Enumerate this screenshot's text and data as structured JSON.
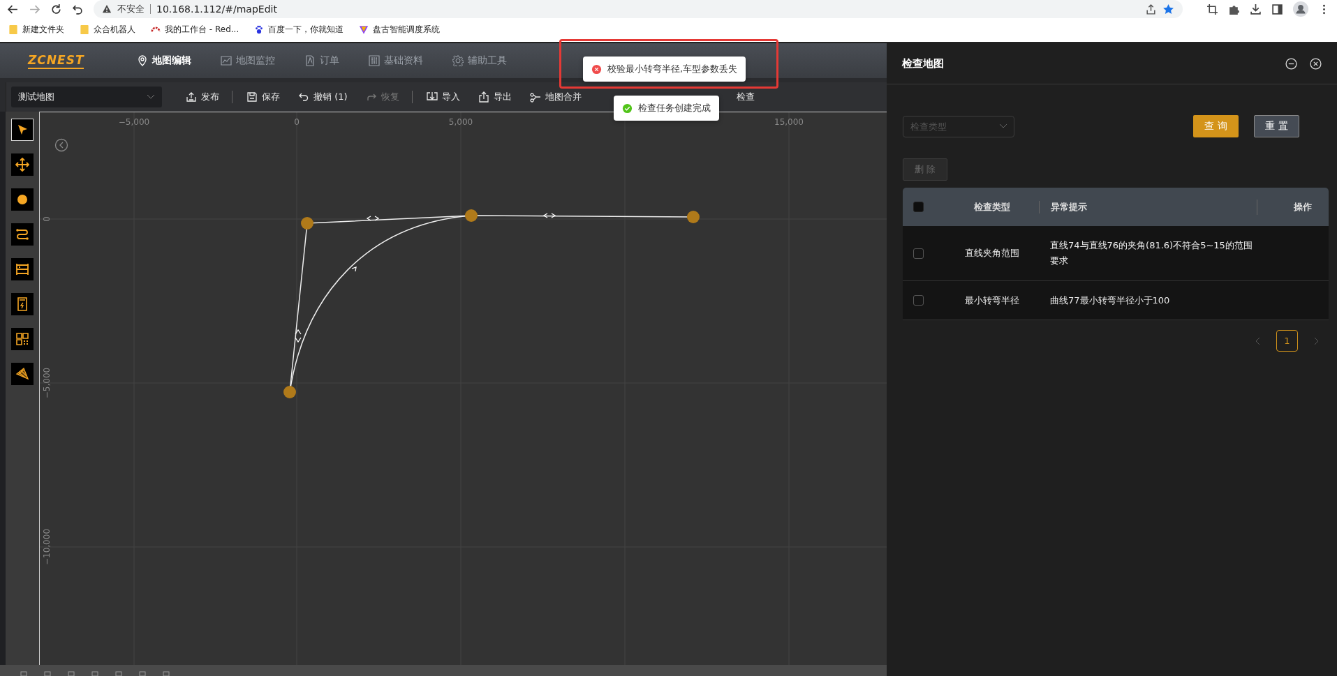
{
  "browser": {
    "security": "不安全",
    "url": "10.168.1.112/#/mapEdit",
    "bookmarks": [
      {
        "label": "新建文件夹",
        "kind": "folder"
      },
      {
        "label": "众合机器人",
        "kind": "folder"
      },
      {
        "label": "我的工作台 - Red...",
        "kind": "arc"
      },
      {
        "label": "百度一下，你就知道",
        "kind": "paw"
      },
      {
        "label": "盘古智能调度系统",
        "kind": "v"
      }
    ]
  },
  "app": {
    "logo": "ZCNEST",
    "nav": [
      {
        "label": "地图编辑",
        "kind": "pin",
        "selected": true
      },
      {
        "label": "地图监控",
        "kind": "chart",
        "selected": false
      },
      {
        "label": "订单",
        "kind": "doc",
        "selected": false
      },
      {
        "label": "基础资料",
        "kind": "sliders",
        "selected": false
      },
      {
        "label": "辅助工具",
        "kind": "gear",
        "selected": false
      }
    ]
  },
  "toolbar": {
    "map_select": "测试地图",
    "actions": [
      {
        "label": "发布",
        "kind": "publish",
        "disabled": false,
        "divider_after": true
      },
      {
        "label": "保存",
        "kind": "save",
        "disabled": false,
        "divider_after": false
      },
      {
        "label": "撤销 (1)",
        "kind": "undo",
        "disabled": false,
        "divider_after": false
      },
      {
        "label": "恢复",
        "kind": "redo",
        "disabled": true,
        "divider_after": true
      },
      {
        "label": "导入",
        "kind": "import",
        "disabled": false,
        "divider_after": false
      },
      {
        "label": "导出",
        "kind": "export",
        "disabled": false,
        "divider_after": false
      },
      {
        "label": "地图合并",
        "kind": "merge",
        "disabled": false,
        "divider_after": false
      },
      {
        "label": "检查",
        "kind": "none",
        "disabled": false,
        "divider_after": false
      }
    ]
  },
  "tools": [
    {
      "kind": "pointer",
      "selected": true
    },
    {
      "kind": "move",
      "selected": false
    },
    {
      "kind": "point",
      "selected": false
    },
    {
      "kind": "route",
      "selected": false
    },
    {
      "kind": "rack",
      "selected": false
    },
    {
      "kind": "charger",
      "selected": false
    },
    {
      "kind": "grid",
      "selected": false
    },
    {
      "kind": "area",
      "selected": false
    }
  ],
  "canvas": {
    "x_ticks": [
      "−5,000",
      "0",
      "5,000",
      "15,000"
    ],
    "y_ticks": [
      "0",
      "−5,000",
      "−10,000"
    ]
  },
  "toasts": [
    {
      "kind": "error",
      "text": "校验最小转弯半径,车型参数丢失"
    },
    {
      "kind": "success",
      "text": "检查任务创建完成"
    }
  ],
  "panel": {
    "title": "检查地图",
    "filter": {
      "placeholder": "检查类型"
    },
    "query_button": "查 询",
    "reset_button": "重 置",
    "delete_button": "删 除",
    "table": {
      "columns": [
        "检查类型",
        "异常提示",
        "操作"
      ],
      "all_checked": false,
      "rows": [
        {
          "type": "直线夹角范围",
          "message": "直线74与直线76的夹角(81.6)不符合5~15的范围要求",
          "selected": false
        },
        {
          "type": "最小转弯半径",
          "message": "曲线77最小转弯半径小于100",
          "selected": false
        }
      ]
    },
    "pagination": {
      "pages": [
        {
          "label": "1",
          "selected": true
        }
      ]
    }
  }
}
